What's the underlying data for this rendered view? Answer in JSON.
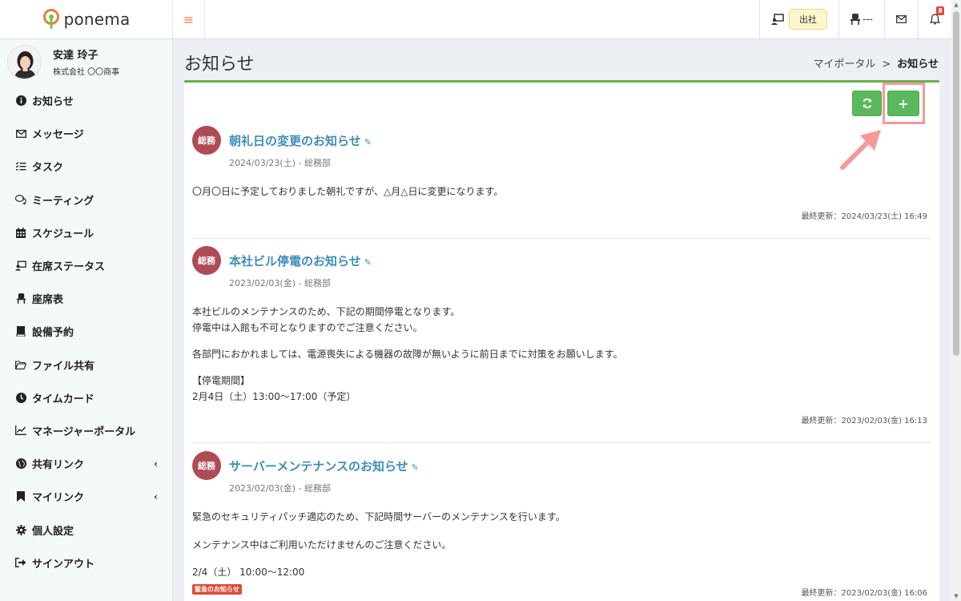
{
  "app": {
    "name": "ponema"
  },
  "header": {
    "status_label": "出社",
    "seat_label": "---",
    "notification_count": "8"
  },
  "user": {
    "name": "安達 玲子",
    "company": "株式会社 〇〇商事"
  },
  "sidebar": {
    "items": [
      {
        "label": "お知らせ",
        "icon": "info-icon"
      },
      {
        "label": "メッセージ",
        "icon": "envelope-icon"
      },
      {
        "label": "タスク",
        "icon": "tasks-icon"
      },
      {
        "label": "ミーティング",
        "icon": "comments-icon"
      },
      {
        "label": "スケジュール",
        "icon": "calendar-icon"
      },
      {
        "label": "在席ステータス",
        "icon": "presence-icon"
      },
      {
        "label": "座席表",
        "icon": "chair-icon"
      },
      {
        "label": "設備予約",
        "icon": "book-icon"
      },
      {
        "label": "ファイル共有",
        "icon": "folder-icon"
      },
      {
        "label": "タイムカード",
        "icon": "clock-icon"
      },
      {
        "label": "マネージャーポータル",
        "icon": "chart-icon"
      },
      {
        "label": "共有リンク",
        "icon": "globe-icon"
      },
      {
        "label": "マイリンク",
        "icon": "bookmark-icon"
      },
      {
        "label": "個人設定",
        "icon": "gear-icon"
      },
      {
        "label": "サインアウト",
        "icon": "sign-out-icon"
      }
    ]
  },
  "page": {
    "title": "お知らせ",
    "breadcrumb": {
      "parent": "マイポータル",
      "separator": ">",
      "current": "お知らせ"
    }
  },
  "notices": [
    {
      "category": "総務",
      "title": "朝礼日の変更のお知らせ",
      "meta": "2024/03/23(土) - 総務部",
      "body": [
        "〇月〇日に予定しておりました朝礼ですが、△月△日に変更になります。"
      ],
      "updated": "最終更新：2024/03/23(土) 16:49"
    },
    {
      "category": "総務",
      "title": "本社ビル停電のお知らせ",
      "meta": "2023/02/03(金) - 総務部",
      "body": [
        "本社ビルのメンテナンスのため、下記の期間停電となります。",
        "停電中は入館も不可となりますのでご注意ください。",
        "各部門におかれましては、電源喪失による機器の故障が無いように前日までに対策をお願いします。",
        "【停電期間】",
        "2月4日（土）13:00～17:00（予定）"
      ],
      "updated": "最終更新：2023/02/03(金) 16:13"
    },
    {
      "category": "総務",
      "title": "サーバーメンテナンスのお知らせ",
      "meta": "2023/02/03(金) - 総務部",
      "body": [
        "緊急のセキュリティパッチ適応のため、下記時間サーバーのメンテナンスを行います。",
        "メンテナンス中はご利用いただけませんのご注意ください。",
        "2/4（土） 10:00～12:00"
      ],
      "tag": "緊急のお知らせ",
      "updated": "最終更新：2023/02/03(金) 16:06"
    }
  ],
  "colors": {
    "accent": "#6ab04c",
    "button": "#5cb85c",
    "link": "#3c8dbc",
    "category": "#b04a53",
    "highlight": "#f49a9a"
  }
}
